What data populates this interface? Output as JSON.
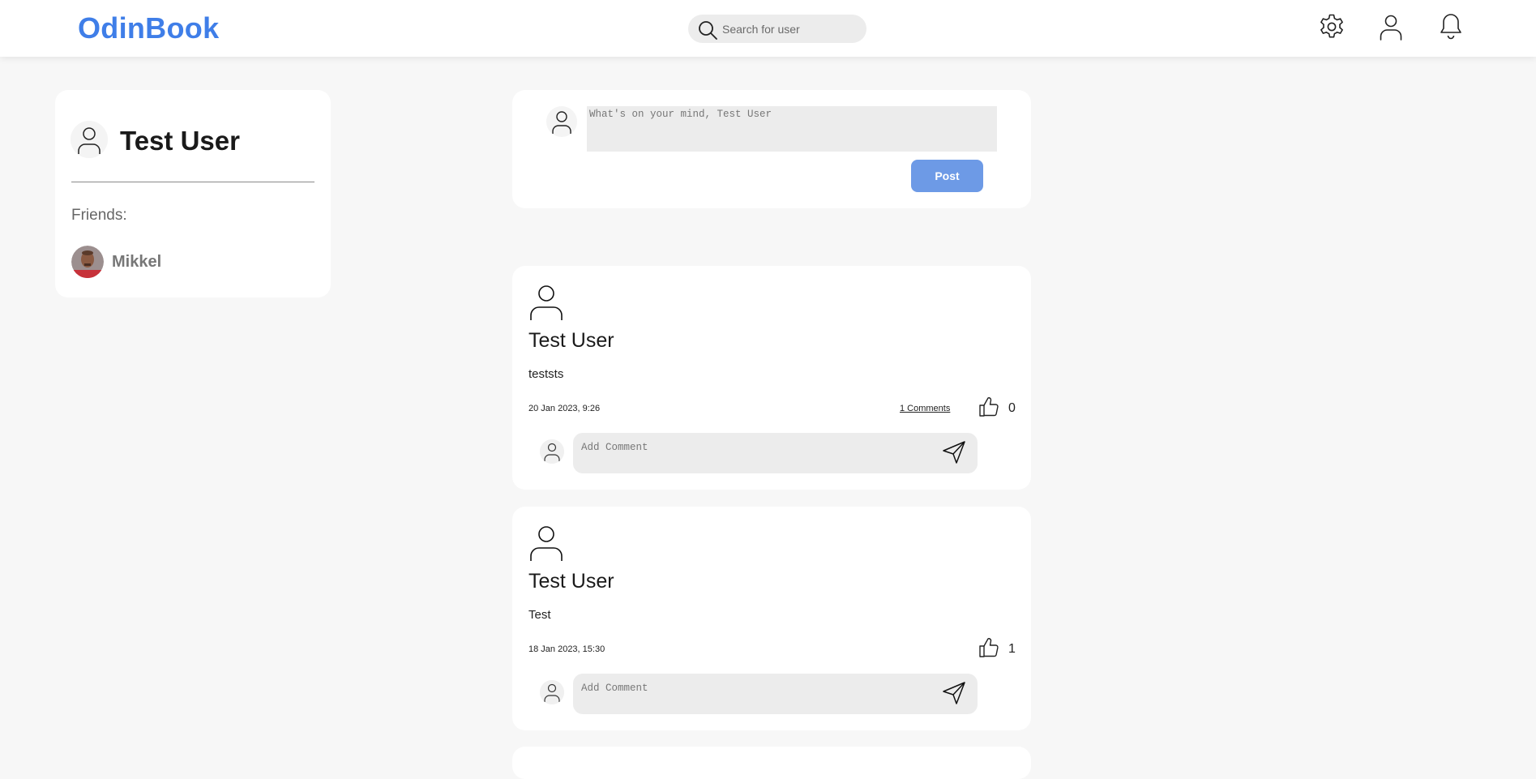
{
  "header": {
    "logo": "OdinBook",
    "search_placeholder": "Search for user",
    "icons": [
      "gear-icon",
      "user-icon",
      "bell-icon"
    ]
  },
  "profile": {
    "name": "Test User",
    "friends_label": "Friends:",
    "friends": [
      {
        "name": "Mikkel"
      }
    ]
  },
  "composer": {
    "placeholder": "What's on your mind, Test User",
    "post_label": "Post"
  },
  "posts": [
    {
      "author": "Test User",
      "body": "teststs",
      "date": "20 Jan 2023, 9:26",
      "comments_label": "1 Comments",
      "likes": "0",
      "comment_placeholder": "Add Comment"
    },
    {
      "author": "Test User",
      "body": "Test",
      "date": "18 Jan 2023, 15:30",
      "comments_label": "",
      "likes": "1",
      "comment_placeholder": "Add Comment"
    }
  ],
  "colors": {
    "brand": "#3f7ee8",
    "post_button": "#6d9ae6",
    "page_bg": "#f7f7f7"
  }
}
